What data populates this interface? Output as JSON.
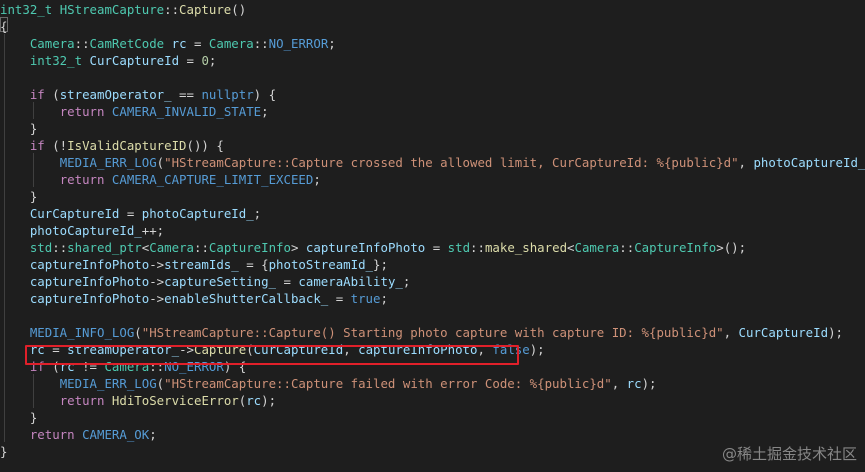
{
  "colors": {
    "background": "#1e1e1e",
    "type": "#4ec9b0",
    "keyword": "#569cd6",
    "control": "#c586c0",
    "variable": "#9cdcfe",
    "function": "#dcdcaa",
    "string": "#ce9178",
    "number": "#b5cea8",
    "highlight_border": "#e0202a"
  },
  "watermark": {
    "text": "@稀土掘金技术社区"
  },
  "code_lines": [
    [
      [
        "type",
        "int32_t"
      ],
      [
        "pun",
        " "
      ],
      [
        "type",
        "HStreamCapture"
      ],
      [
        "pun",
        "::"
      ],
      [
        "fn",
        "Capture"
      ],
      [
        "pun",
        "()"
      ]
    ],
    [
      [
        "pun",
        "{"
      ]
    ],
    [
      [
        "pun",
        "    "
      ],
      [
        "type",
        "Camera"
      ],
      [
        "pun",
        "::"
      ],
      [
        "type",
        "CamRetCode"
      ],
      [
        "pun",
        " "
      ],
      [
        "var",
        "rc"
      ],
      [
        "pun",
        " = "
      ],
      [
        "type",
        "Camera"
      ],
      [
        "pun",
        "::"
      ],
      [
        "mac",
        "NO_ERROR"
      ],
      [
        "pun",
        ";"
      ]
    ],
    [
      [
        "pun",
        "    "
      ],
      [
        "type",
        "int32_t"
      ],
      [
        "pun",
        " "
      ],
      [
        "var",
        "CurCaptureId"
      ],
      [
        "pun",
        " = "
      ],
      [
        "num",
        "0"
      ],
      [
        "pun",
        ";"
      ]
    ],
    [],
    [
      [
        "pun",
        "    "
      ],
      [
        "ctrl",
        "if"
      ],
      [
        "pun",
        " ("
      ],
      [
        "var",
        "streamOperator_"
      ],
      [
        "pun",
        " == "
      ],
      [
        "kw",
        "nullptr"
      ],
      [
        "pun",
        ") {"
      ]
    ],
    [
      [
        "pun",
        "        "
      ],
      [
        "ctrl",
        "return"
      ],
      [
        "pun",
        " "
      ],
      [
        "mac",
        "CAMERA_INVALID_STATE"
      ],
      [
        "pun",
        ";"
      ]
    ],
    [
      [
        "pun",
        "    }"
      ]
    ],
    [
      [
        "pun",
        "    "
      ],
      [
        "ctrl",
        "if"
      ],
      [
        "pun",
        " (!"
      ],
      [
        "fn",
        "IsValidCaptureID"
      ],
      [
        "pun",
        "()) {"
      ]
    ],
    [
      [
        "pun",
        "        "
      ],
      [
        "mac",
        "MEDIA_ERR_LOG"
      ],
      [
        "pun",
        "("
      ],
      [
        "str",
        "\"HStreamCapture::Capture crossed the allowed limit, CurCaptureId: %{public}d\""
      ],
      [
        "pun",
        ", "
      ],
      [
        "var",
        "photoCaptureId_"
      ],
      [
        "pun",
        ");"
      ]
    ],
    [
      [
        "pun",
        "        "
      ],
      [
        "ctrl",
        "return"
      ],
      [
        "pun",
        " "
      ],
      [
        "mac",
        "CAMERA_CAPTURE_LIMIT_EXCEED"
      ],
      [
        "pun",
        ";"
      ]
    ],
    [
      [
        "pun",
        "    }"
      ]
    ],
    [
      [
        "pun",
        "    "
      ],
      [
        "var",
        "CurCaptureId"
      ],
      [
        "pun",
        " = "
      ],
      [
        "var",
        "photoCaptureId_"
      ],
      [
        "pun",
        ";"
      ]
    ],
    [
      [
        "pun",
        "    "
      ],
      [
        "var",
        "photoCaptureId_"
      ],
      [
        "pun",
        "++;"
      ]
    ],
    [
      [
        "pun",
        "    "
      ],
      [
        "type",
        "std"
      ],
      [
        "pun",
        "::"
      ],
      [
        "type",
        "shared_ptr"
      ],
      [
        "pun",
        "<"
      ],
      [
        "type",
        "Camera"
      ],
      [
        "pun",
        "::"
      ],
      [
        "type",
        "CaptureInfo"
      ],
      [
        "pun",
        "> "
      ],
      [
        "var",
        "captureInfoPhoto"
      ],
      [
        "pun",
        " = "
      ],
      [
        "type",
        "std"
      ],
      [
        "pun",
        "::"
      ],
      [
        "fn",
        "make_shared"
      ],
      [
        "pun",
        "<"
      ],
      [
        "type",
        "Camera"
      ],
      [
        "pun",
        "::"
      ],
      [
        "type",
        "CaptureInfo"
      ],
      [
        "pun",
        ">();"
      ]
    ],
    [
      [
        "pun",
        "    "
      ],
      [
        "var",
        "captureInfoPhoto"
      ],
      [
        "pun",
        "->"
      ],
      [
        "var",
        "streamIds_"
      ],
      [
        "pun",
        " = {"
      ],
      [
        "var",
        "photoStreamId_"
      ],
      [
        "pun",
        "};"
      ]
    ],
    [
      [
        "pun",
        "    "
      ],
      [
        "var",
        "captureInfoPhoto"
      ],
      [
        "pun",
        "->"
      ],
      [
        "var",
        "captureSetting_"
      ],
      [
        "pun",
        " = "
      ],
      [
        "var",
        "cameraAbility_"
      ],
      [
        "pun",
        ";"
      ]
    ],
    [
      [
        "pun",
        "    "
      ],
      [
        "var",
        "captureInfoPhoto"
      ],
      [
        "pun",
        "->"
      ],
      [
        "var",
        "enableShutterCallback_"
      ],
      [
        "pun",
        " = "
      ],
      [
        "kw",
        "true"
      ],
      [
        "pun",
        ";"
      ]
    ],
    [],
    [
      [
        "pun",
        "    "
      ],
      [
        "mac",
        "MEDIA_INFO_LOG"
      ],
      [
        "pun",
        "("
      ],
      [
        "str",
        "\"HStreamCapture::Capture() Starting photo capture with capture ID: %{public}d\""
      ],
      [
        "pun",
        ", "
      ],
      [
        "var",
        "CurCaptureId"
      ],
      [
        "pun",
        ");"
      ]
    ],
    [
      [
        "pun",
        "    "
      ],
      [
        "var",
        "rc"
      ],
      [
        "pun",
        " = "
      ],
      [
        "var",
        "streamOperator_"
      ],
      [
        "pun",
        "->"
      ],
      [
        "fn",
        "Capture"
      ],
      [
        "pun",
        "("
      ],
      [
        "var",
        "CurCaptureId"
      ],
      [
        "pun",
        ", "
      ],
      [
        "var",
        "captureInfoPhoto"
      ],
      [
        "pun",
        ", "
      ],
      [
        "kw",
        "false"
      ],
      [
        "pun",
        ");"
      ]
    ],
    [
      [
        "pun",
        "    "
      ],
      [
        "ctrl",
        "if"
      ],
      [
        "pun",
        " ("
      ],
      [
        "var",
        "rc"
      ],
      [
        "pun",
        " != "
      ],
      [
        "type",
        "Camera"
      ],
      [
        "pun",
        "::"
      ],
      [
        "mac",
        "NO_ERROR"
      ],
      [
        "pun",
        ") {"
      ]
    ],
    [
      [
        "pun",
        "        "
      ],
      [
        "mac",
        "MEDIA_ERR_LOG"
      ],
      [
        "pun",
        "("
      ],
      [
        "str",
        "\"HStreamCapture::Capture failed with error Code: %{public}d\""
      ],
      [
        "pun",
        ", "
      ],
      [
        "var",
        "rc"
      ],
      [
        "pun",
        ");"
      ]
    ],
    [
      [
        "pun",
        "        "
      ],
      [
        "ctrl",
        "return"
      ],
      [
        "pun",
        " "
      ],
      [
        "fn",
        "HdiToServiceError"
      ],
      [
        "pun",
        "("
      ],
      [
        "var",
        "rc"
      ],
      [
        "pun",
        ");"
      ]
    ],
    [
      [
        "pun",
        "    }"
      ]
    ],
    [
      [
        "pun",
        "    "
      ],
      [
        "ctrl",
        "return"
      ],
      [
        "pun",
        " "
      ],
      [
        "mac",
        "CAMERA_OK"
      ],
      [
        "pun",
        ";"
      ]
    ],
    [
      [
        "pun",
        "}"
      ]
    ]
  ]
}
